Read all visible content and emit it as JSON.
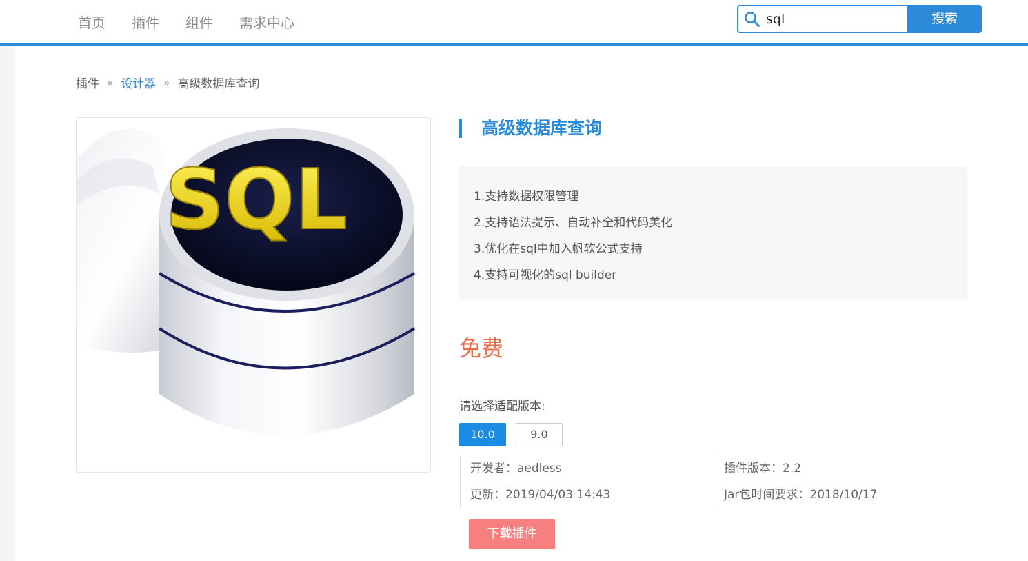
{
  "nav": {
    "items": [
      {
        "label": "首页"
      },
      {
        "label": "插件"
      },
      {
        "label": "组件"
      },
      {
        "label": "需求中心"
      }
    ]
  },
  "search": {
    "value": "sql",
    "button_label": "搜索"
  },
  "breadcrumb": {
    "items": [
      {
        "label": "插件"
      },
      {
        "label": "设计器"
      },
      {
        "label": "高级数据库查询"
      }
    ],
    "separator": "»"
  },
  "product": {
    "title": "高级数据库查询",
    "image_text": "SQL",
    "features": [
      "1.支持数据权限管理",
      "2.支持语法提示、自动补全和代码美化",
      "3.优化在sql中加入帆软公式支持",
      "4.支持可视化的sql builder"
    ],
    "price": "免费",
    "version_label": "请选择适配版本:",
    "versions": [
      "10.0",
      "9.0"
    ],
    "developer": "开发者：aedless",
    "plugin_version": "插件版本：2.2",
    "updated": "更新：2019/04/03 14:43",
    "jar_requirement": "Jar包时间要求：2018/10/17",
    "download_label": "下载插件"
  },
  "colors": {
    "accent": "#2b8ad9",
    "price": "#ee6a4b",
    "download": "#f87f7f"
  }
}
